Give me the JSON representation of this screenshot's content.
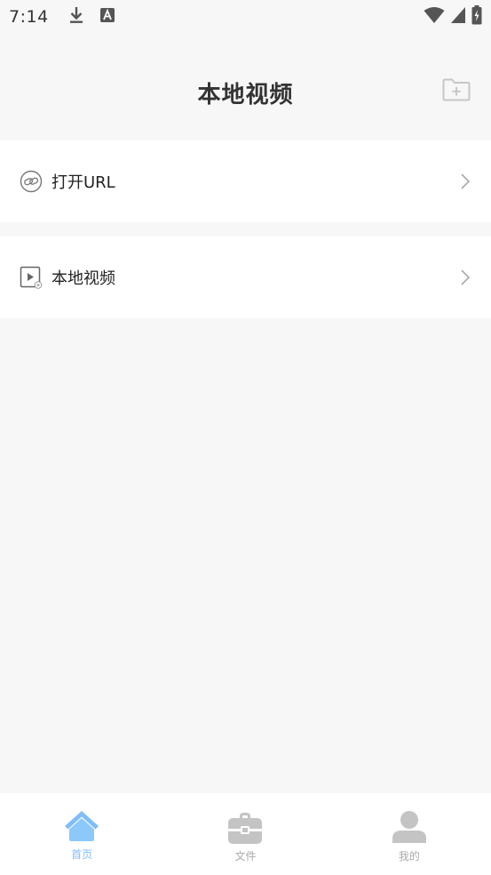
{
  "status_bar": {
    "time": "7:14",
    "icons_left": [
      "download-icon",
      "font-a-icon"
    ],
    "icons_right": [
      "wifi-icon",
      "cell-signal-icon",
      "battery-icon"
    ]
  },
  "header": {
    "title": "本地视频",
    "action_icon": "folder-add-icon"
  },
  "list": {
    "items": [
      {
        "label": "打开URL",
        "icon": "link-icon"
      },
      {
        "label": "本地视频",
        "icon": "video-file-icon"
      }
    ]
  },
  "tab_bar": {
    "tabs": [
      {
        "label": "首页",
        "icon": "home-icon",
        "active": true
      },
      {
        "label": "文件",
        "icon": "briefcase-icon",
        "active": false
      },
      {
        "label": "我的",
        "icon": "person-icon",
        "active": false
      }
    ]
  },
  "colors": {
    "background": "#f7f7f7",
    "card": "#ffffff",
    "accent": "#7fbef7",
    "inactive": "#bbbbbb",
    "title": "#333333"
  }
}
